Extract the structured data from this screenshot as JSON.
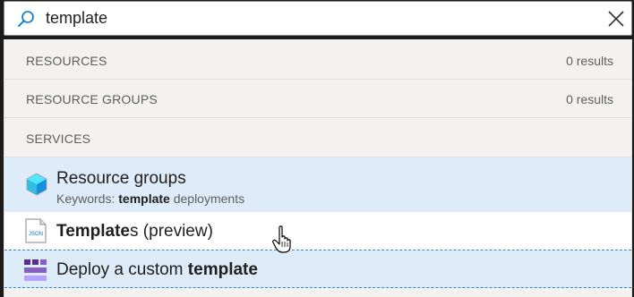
{
  "search": {
    "query": "template"
  },
  "sections": {
    "resources": {
      "title": "RESOURCES",
      "count": "0 results"
    },
    "resource_groups": {
      "title": "RESOURCE GROUPS",
      "count": "0 results"
    },
    "services": {
      "title": "SERVICES"
    }
  },
  "items": {
    "resource_groups": {
      "title": "Resource groups",
      "keywords_prefix": "Keywords: ",
      "keywords_bold": "template",
      "keywords_rest": " deployments"
    },
    "templates": {
      "title_bold": "Template",
      "title_rest": "s (preview)",
      "icon_text": "JSON"
    },
    "deploy": {
      "title_pre": "Deploy a custom ",
      "title_bold": "template"
    }
  },
  "colors": {
    "highlight": "#deecf9",
    "accent": "#0078d4",
    "panel": "#f3f2f1"
  }
}
